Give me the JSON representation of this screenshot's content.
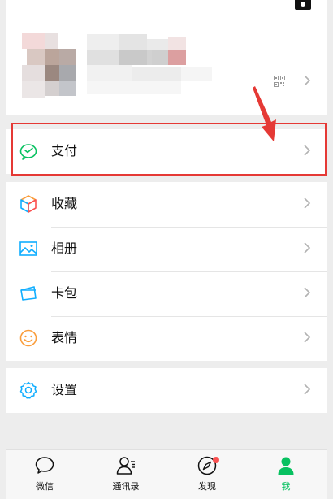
{
  "menu": {
    "pay": {
      "label": "支付",
      "icon": "wechat-pay-icon"
    },
    "favorites": {
      "label": "收藏",
      "icon": "cube-icon"
    },
    "album": {
      "label": "相册",
      "icon": "image-icon"
    },
    "cards": {
      "label": "卡包",
      "icon": "card-icon"
    },
    "stickers": {
      "label": "表情",
      "icon": "smiley-icon"
    },
    "settings": {
      "label": "设置",
      "icon": "gear-icon"
    }
  },
  "tabbar": {
    "items": [
      {
        "label": "微信",
        "icon": "chat-icon"
      },
      {
        "label": "通讯录",
        "icon": "contacts-icon"
      },
      {
        "label": "发现",
        "icon": "compass-icon"
      },
      {
        "label": "我",
        "icon": "profile-icon"
      }
    ],
    "active_index": 3
  },
  "colors": {
    "accent": "#07c160",
    "highlight": "#e53935",
    "badge": "#fa5151"
  }
}
